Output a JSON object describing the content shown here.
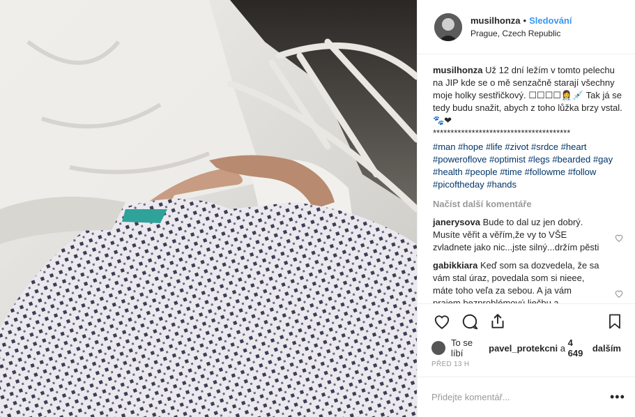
{
  "header": {
    "username": "musilhonza",
    "separator": "•",
    "follow_label": "Sledování",
    "location": "Prague, Czech Republic"
  },
  "caption": {
    "username": "musilhonza",
    "text": "Už 12 dní ležím v tomto pelechu na JIP kde se o mě senzačně starají všechny moje holky sestřičkový. ☐☐☐☐👩‍⚕️💉 Tak já se tedy budu snažit, abych z toho lůžka brzy vstal. 🐾❤",
    "stars": "***************************************",
    "hashtags": [
      "#man",
      "#hope",
      "#life",
      "#zivot",
      "#srdce",
      "#heart",
      "#poweroflove",
      "#optimist",
      "#legs",
      "#bearded",
      "#gay",
      "#health",
      "#people",
      "#time",
      "#followme",
      "#follow",
      "#picoftheday",
      "#hands"
    ]
  },
  "load_more": "Načíst další komentáře",
  "comments": [
    {
      "username": "janerysova",
      "text": "Bude to dal uz jen dobrý. Musíte věřit a věřím,že vy to VŠE zvladnete jako nic...jste silný...držím pěsti"
    },
    {
      "username": "gabikkiara",
      "text": "Keď som sa dozvedela, že sa vám stal úraz, povedala som si nieee, máte toho veľa za sebou. A ja vám prajem bezproblémovú liečbu a"
    }
  ],
  "likes": {
    "prefix": "To se líbí",
    "user": "pavel_protekcni",
    "middle": "a",
    "count": "4 649",
    "suffix": "dalším"
  },
  "timestamp": "PŘED 13 H",
  "add_comment": {
    "placeholder": "Přidejte komentář..."
  },
  "options_glyph": "•••",
  "icons": [
    "heart-icon",
    "comment-icon",
    "share-icon",
    "bookmark-icon",
    "more-options-icon"
  ]
}
